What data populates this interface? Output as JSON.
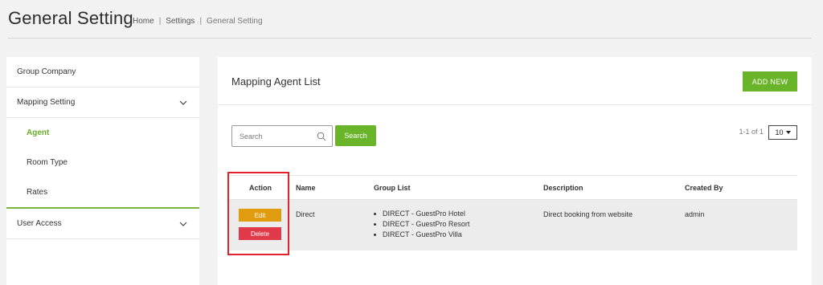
{
  "header": {
    "title": "General Setting",
    "breadcrumb": [
      "Home",
      "Settings",
      "General Setting"
    ],
    "separator": "|"
  },
  "sidebar": {
    "items": [
      {
        "label": "Group Company"
      },
      {
        "label": "Mapping Setting",
        "icon": "chevron-down-icon"
      },
      {
        "label": "User Access",
        "icon": "chevron-down-icon"
      }
    ],
    "sub_items": [
      {
        "label": "Agent",
        "active": true
      },
      {
        "label": "Room Type"
      },
      {
        "label": "Rates"
      }
    ]
  },
  "panel": {
    "title": "Mapping Agent List",
    "add_label": "ADD NEW"
  },
  "search": {
    "placeholder": "Search",
    "button_label": "Search"
  },
  "pager": {
    "info": "1-1 of 1",
    "page_size": "10"
  },
  "table": {
    "columns": [
      "Action",
      "Name",
      "Group List",
      "Description",
      "Created By"
    ],
    "rows": [
      {
        "name": "Direct",
        "group_list": [
          "DIRECT - GuestPro Hotel",
          "DIRECT - GuestPro Resort",
          "DIRECT - GuestPro Villa"
        ],
        "description": "Direct booking from website",
        "created_by": "admin",
        "edit_label": "Edit",
        "delete_label": "Delete"
      }
    ]
  },
  "colors": {
    "accent": "#6ab42a",
    "edit": "#e19b0e",
    "delete": "#e03a4a",
    "highlight": "#e3232b"
  }
}
